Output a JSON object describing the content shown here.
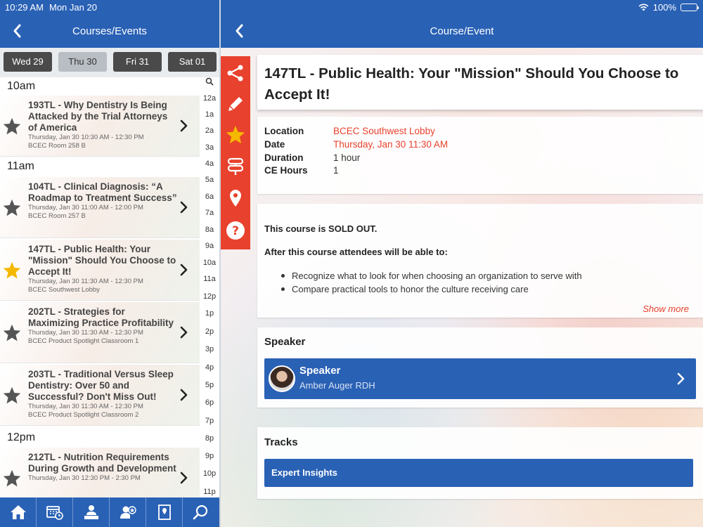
{
  "status_bar": {
    "time": "10:29 AM",
    "date": "Mon Jan 20",
    "battery": "100%"
  },
  "left_nav": {
    "title": "Courses/Events"
  },
  "right_nav": {
    "title": "Course/Event"
  },
  "day_tabs": [
    {
      "label": "Wed 29",
      "active": false
    },
    {
      "label": "Thu 30",
      "active": true
    },
    {
      "label": "Fri 31",
      "active": false
    },
    {
      "label": "Sat 01",
      "active": false
    }
  ],
  "hours": [
    {
      "label": "10am"
    },
    {
      "label": "11am"
    },
    {
      "label": "12pm"
    }
  ],
  "items": [
    {
      "title": "193TL - Why Dentistry Is Being Attacked by the Trial Attorneys of America",
      "when": "Thursday, Jan 30 10:30 AM - 12:30 PM",
      "where": "BCEC Room 258 B",
      "starred": false
    },
    {
      "title": "104TL - Clinical Diagnosis: “A Roadmap to Treatment Success”",
      "when": "Thursday, Jan 30 11:00 AM - 12:00 PM",
      "where": "BCEC Room 257 B",
      "starred": false
    },
    {
      "title": "147TL - Public Health: Your \"Mission\" Should You Choose to Accept It!",
      "when": "Thursday, Jan 30 11:30 AM - 12:30 PM",
      "where": "BCEC Southwest Lobby",
      "starred": true
    },
    {
      "title": "202TL - Strategies for Maximizing Practice Profitability",
      "when": "Thursday, Jan 30 11:30 AM - 12:30 PM",
      "where": "BCEC Product Spotlight Classroom 1",
      "starred": false
    },
    {
      "title": "203TL - Traditional Versus Sleep Dentistry: Over 50 and Successful? Don't Miss Out!",
      "when": "Thursday, Jan 30 11:30 AM - 12:30 PM",
      "where": "BCEC Product Spotlight Classroom 2",
      "starred": false
    },
    {
      "title": "212TL - Nutrition Requirements During Growth and Development",
      "when": "Thursday, Jan 30 12:30 PM - 2:30 PM",
      "where": "",
      "starred": false
    }
  ],
  "hour_index": [
    "12a",
    "1a",
    "2a",
    "3a",
    "4a",
    "5a",
    "6a",
    "7a",
    "8a",
    "9a",
    "10a",
    "11a",
    "12p",
    "1p",
    "2p",
    "3p",
    "4p",
    "5p",
    "6p",
    "7p",
    "8p",
    "9p",
    "10p",
    "11p"
  ],
  "tabbar": [
    "home-icon",
    "schedule-icon",
    "presenter-icon",
    "speaker-star-icon",
    "map-icon",
    "search-icon"
  ],
  "toolbar": [
    "share-icon",
    "edit-icon",
    "star-icon",
    "signpost-icon",
    "location-pin-icon",
    "help-icon"
  ],
  "event": {
    "title": "147TL - Public Health: Your \"Mission\" Should You Choose to Accept It!",
    "info": [
      {
        "key": "Location",
        "value": "BCEC Southwest Lobby",
        "red": true
      },
      {
        "key": "Date",
        "value": "Thursday, Jan 30 11:30 AM",
        "red": true
      },
      {
        "key": "Duration",
        "value": "1 hour",
        "red": false
      },
      {
        "key": "CE Hours",
        "value": "1",
        "red": false
      }
    ],
    "sold_out": "This course is SOLD OUT.",
    "objectives_intro": "After this course attendees will be able to:",
    "objectives": [
      "Recognize what to look for when choosing an organization to serve with",
      "Compare practical tools to honor the culture receiving care"
    ],
    "show_more": "Show more",
    "speaker_header": "Speaker",
    "speaker_role": "Speaker",
    "speaker_name": "Amber Auger RDH",
    "tracks_header": "Tracks",
    "track": "Expert Insights"
  },
  "colors": {
    "brand_blue": "#2961b5",
    "accent_red": "#e8412d",
    "star_gold": "#f5b800",
    "star_gray": "#555555"
  }
}
